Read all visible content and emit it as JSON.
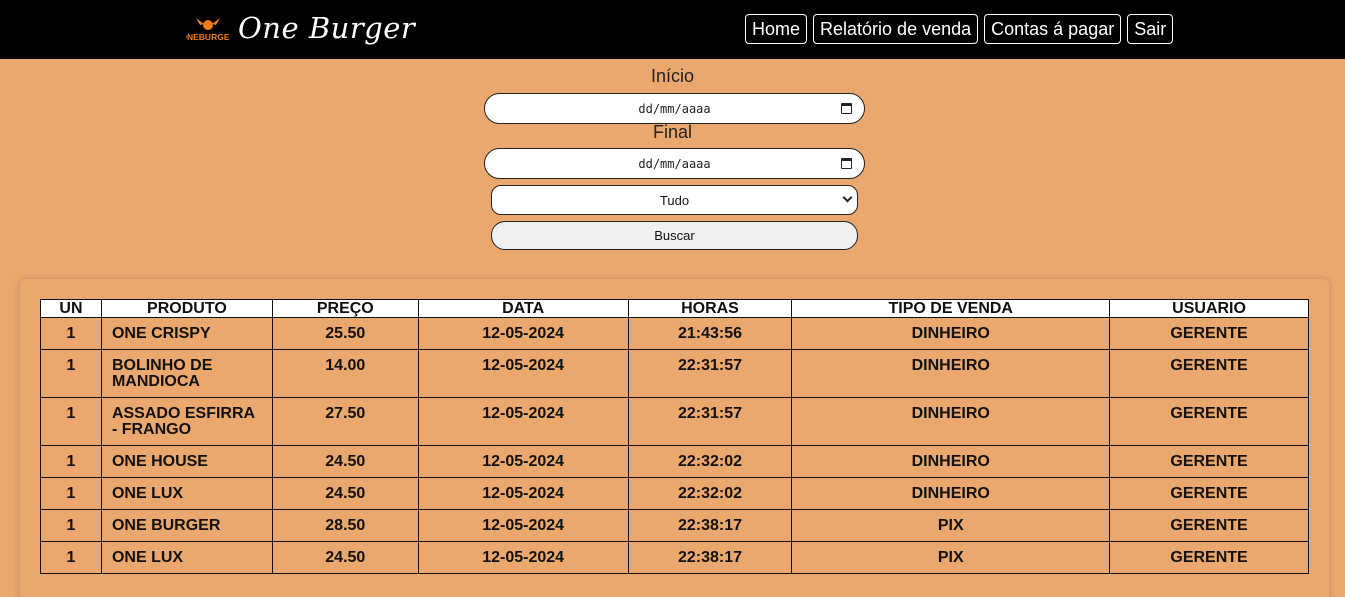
{
  "header": {
    "logo_badge_text": "ONEBURGER",
    "logo_text": "One Burger",
    "nav": [
      {
        "label": "Home"
      },
      {
        "label": "Relatório de venda"
      },
      {
        "label": "Contas á pagar"
      },
      {
        "label": "Sair"
      }
    ]
  },
  "filters": {
    "start_label": "Início",
    "start_value": "dd/mm/aaaa",
    "end_label": "Final",
    "end_value": "dd/mm/aaaa",
    "type_selected": "Tudo",
    "search_label": "Buscar"
  },
  "table": {
    "headers": [
      "UN",
      "PRODUTO",
      "PREÇO",
      "DATA",
      "HORAS",
      "TIPO DE VENDA",
      "USUARIO"
    ],
    "rows": [
      [
        "1",
        "ONE CRISPY",
        "25.50",
        "12-05-2024",
        "21:43:56",
        "DINHEIRO",
        "GERENTE"
      ],
      [
        "1",
        "BOLINHO DE MANDIOCA",
        "14.00",
        "12-05-2024",
        "22:31:57",
        "DINHEIRO",
        "GERENTE"
      ],
      [
        "1",
        "ASSADO ESFIRRA - FRANGO",
        "27.50",
        "12-05-2024",
        "22:31:57",
        "DINHEIRO",
        "GERENTE"
      ],
      [
        "1",
        "ONE HOUSE",
        "24.50",
        "12-05-2024",
        "22:32:02",
        "DINHEIRO",
        "GERENTE"
      ],
      [
        "1",
        "ONE LUX",
        "24.50",
        "12-05-2024",
        "22:32:02",
        "DINHEIRO",
        "GERENTE"
      ],
      [
        "1",
        "ONE BURGER",
        "28.50",
        "12-05-2024",
        "22:38:17",
        "PIX",
        "GERENTE"
      ],
      [
        "1",
        "ONE LUX",
        "24.50",
        "12-05-2024",
        "22:38:17",
        "PIX",
        "GERENTE"
      ]
    ]
  }
}
